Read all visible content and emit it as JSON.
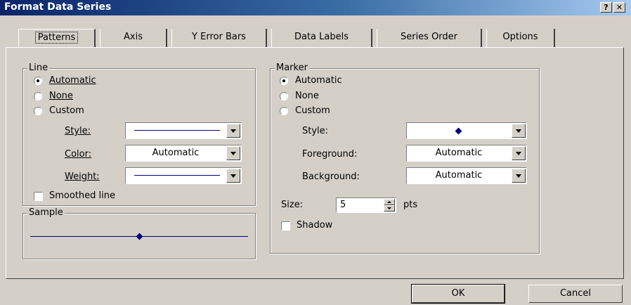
{
  "window": {
    "title": "Format Data Series",
    "help_label": "?",
    "close_label": "✕"
  },
  "tabs": [
    {
      "label": "Patterns"
    },
    {
      "label": "Axis"
    },
    {
      "label": "Y Error Bars"
    },
    {
      "label": "Data Labels"
    },
    {
      "label": "Series Order"
    },
    {
      "label": "Options"
    }
  ],
  "active_tab": "Patterns",
  "line": {
    "group_label": "Line",
    "options": [
      {
        "label": "Automatic",
        "selected": true
      },
      {
        "label": "None",
        "selected": false
      },
      {
        "label": "Custom",
        "selected": false
      }
    ],
    "style_label": "Style:",
    "color_label": "Color:",
    "color_value": "Automatic",
    "weight_label": "Weight:",
    "smoothed_label": "Smoothed line",
    "smoothed_checked": false,
    "line_color": "#000080"
  },
  "sample": {
    "group_label": "Sample"
  },
  "marker": {
    "group_label": "Marker",
    "options": [
      {
        "label": "Automatic",
        "selected": true
      },
      {
        "label": "None",
        "selected": false
      },
      {
        "label": "Custom",
        "selected": false
      }
    ],
    "style_label": "Style:",
    "foreground_label": "Foreground:",
    "foreground_value": "Automatic",
    "background_label": "Background:",
    "background_value": "Automatic",
    "size_label": "Size:",
    "size_value": "5",
    "size_unit": "pts",
    "shadow_label": "Shadow",
    "shadow_checked": false,
    "marker_color": "#000080"
  },
  "buttons": {
    "ok": "OK",
    "cancel": "Cancel"
  }
}
